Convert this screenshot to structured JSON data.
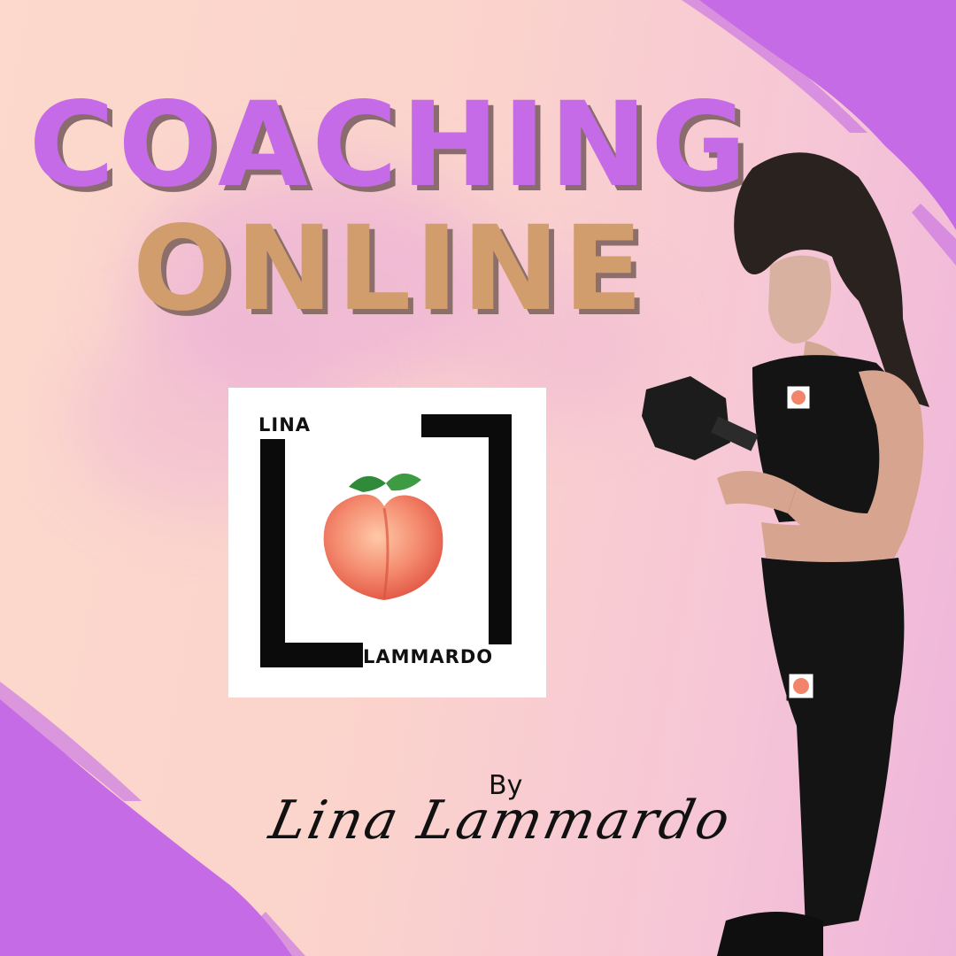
{
  "headline": {
    "line1": "COACHING",
    "line2": "ONLINE"
  },
  "logo": {
    "top_word": "LINA",
    "bottom_word": "LAMMARDO",
    "icon": "peach-icon"
  },
  "byline": {
    "by": "By",
    "signature": "Lina Lammardo"
  },
  "photo": {
    "subject": "woman-with-dumbbell-photo"
  },
  "colors": {
    "background_peach": "#fcd9cc",
    "accent_purple": "#c66be8",
    "accent_gold": "#d19d6c",
    "brush_purple": "#c56be6",
    "outfit_black": "#141414"
  }
}
